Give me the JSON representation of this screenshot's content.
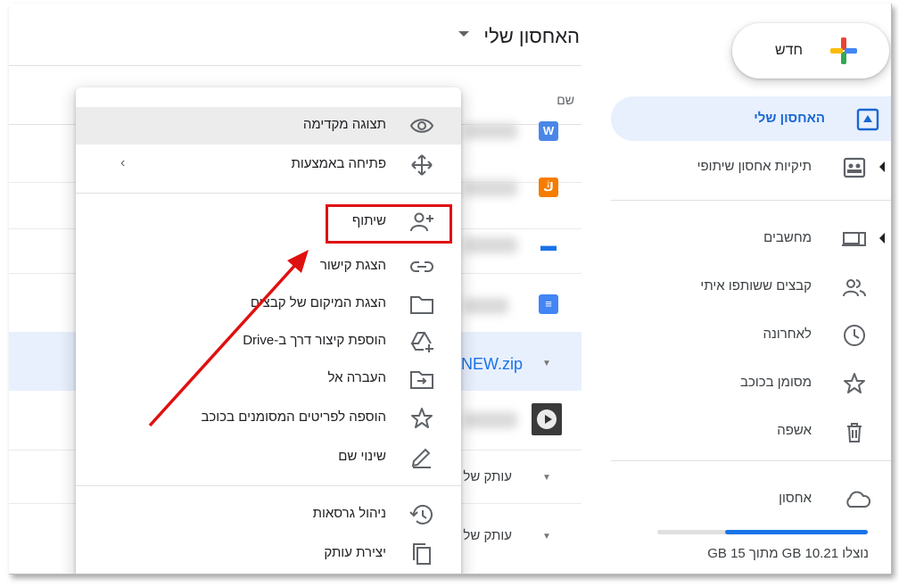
{
  "header": {
    "title": "האחסון שלי",
    "column_name": "שם"
  },
  "files": {
    "zip_name": "NEW.zip",
    "copy_label_1": "עותק של",
    "copy_label_2": "עותק של"
  },
  "new_button": {
    "label": "חדש"
  },
  "sidebar": {
    "items": [
      {
        "label": "האחסון שלי",
        "icon": "drive-icon"
      },
      {
        "label": "תיקיות אחסון שיתופי",
        "icon": "shared-drive-icon"
      },
      {
        "label": "מחשבים",
        "icon": "computers-icon"
      },
      {
        "label": "קבצים ששותפו איתי",
        "icon": "people-icon"
      },
      {
        "label": "לאחרונה",
        "icon": "clock-icon"
      },
      {
        "label": "מסומן בכוכב",
        "icon": "star-icon"
      },
      {
        "label": "אשפה",
        "icon": "trash-icon"
      },
      {
        "label": "אחסון",
        "icon": "cloud-icon"
      }
    ],
    "storage_text": "נוצלו 10.21 GB מתוך 15 GB",
    "storage_used_fraction": 0.68
  },
  "menu": {
    "items": [
      {
        "label": "תצוגה מקדימה",
        "icon": "eye-icon"
      },
      {
        "label": "פתיחה באמצעות",
        "icon": "move-arrows-icon"
      },
      {
        "label": "שיתוף",
        "icon": "add-person-icon"
      },
      {
        "label": "הצגת קישור",
        "icon": "link-icon"
      },
      {
        "label": "הצגת המיקום של קבצים",
        "icon": "folder-icon"
      },
      {
        "label": "הוספת קיצור דרך ב-Drive",
        "icon": "drive-add-icon"
      },
      {
        "label": "העברה אל",
        "icon": "move-to-folder-icon"
      },
      {
        "label": "הוספה לפריטים המסומנים בכוכב",
        "icon": "star-icon"
      },
      {
        "label": "שינוי שם",
        "icon": "pencil-icon"
      },
      {
        "label": "ניהול גרסאות",
        "icon": "history-icon"
      },
      {
        "label": "יצירת עותק",
        "icon": "copy-icon"
      }
    ]
  },
  "colors": {
    "accent": "#1a73e8",
    "active_bg": "#e8f0fe",
    "annotation": "#e01010"
  }
}
